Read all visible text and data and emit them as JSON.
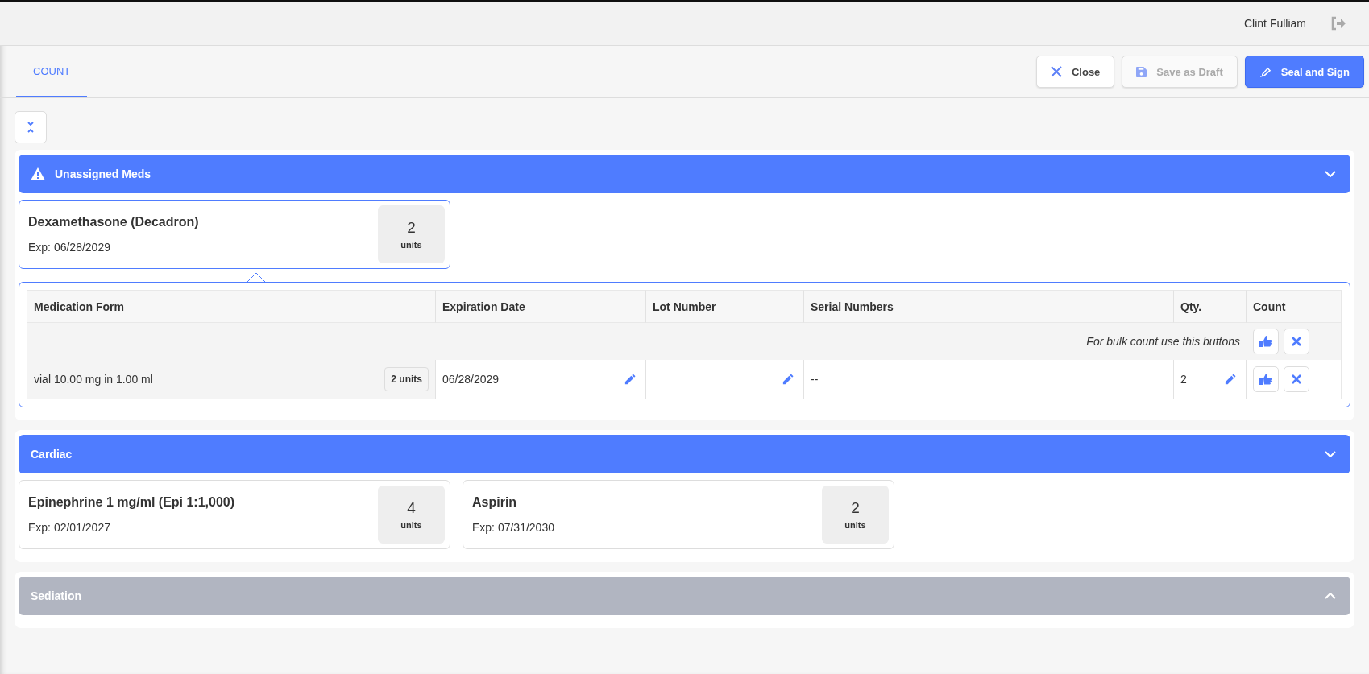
{
  "header": {
    "user_name": "Clint Fulliam"
  },
  "tabs": [
    {
      "label": "COUNT",
      "selected": true
    }
  ],
  "actions": [
    {
      "label": "Close",
      "kind": "close",
      "disabled": false
    },
    {
      "label": "Save as Draft",
      "kind": "draft",
      "disabled": true
    },
    {
      "label": "Seal and Sign",
      "kind": "sign",
      "disabled": false
    }
  ],
  "sections": [
    {
      "title": "Unassigned Meds",
      "warning": true,
      "expanded": true,
      "meds": [
        {
          "name": "Dexamethasone (Decadron)",
          "exp": "Exp: 06/28/2029",
          "qty": "2",
          "unit": "units",
          "selected": true
        }
      ],
      "detail": {
        "columns": [
          "Medication Form",
          "Expiration Date",
          "Lot Number",
          "Serial Numbers",
          "Qty.",
          "Count"
        ],
        "bulk_hint": "For bulk count use this buttons",
        "rows": [
          {
            "form": "vial 10.00 mg in 1.00 ml",
            "units": "2 units",
            "expiration": "06/28/2029",
            "serial": "--",
            "qty": "2"
          }
        ]
      }
    },
    {
      "title": "Cardiac",
      "warning": false,
      "expanded": true,
      "meds": [
        {
          "name": "Epinephrine 1 mg/ml (Epi 1:1,000)",
          "exp": "Exp: 02/01/2027",
          "qty": "4",
          "unit": "units",
          "selected": false
        },
        {
          "name": "Aspirin",
          "exp": "Exp: 07/31/2030",
          "qty": "2",
          "unit": "units",
          "selected": false
        }
      ]
    },
    {
      "title": "Sediation",
      "warning": false,
      "expanded": false
    }
  ]
}
